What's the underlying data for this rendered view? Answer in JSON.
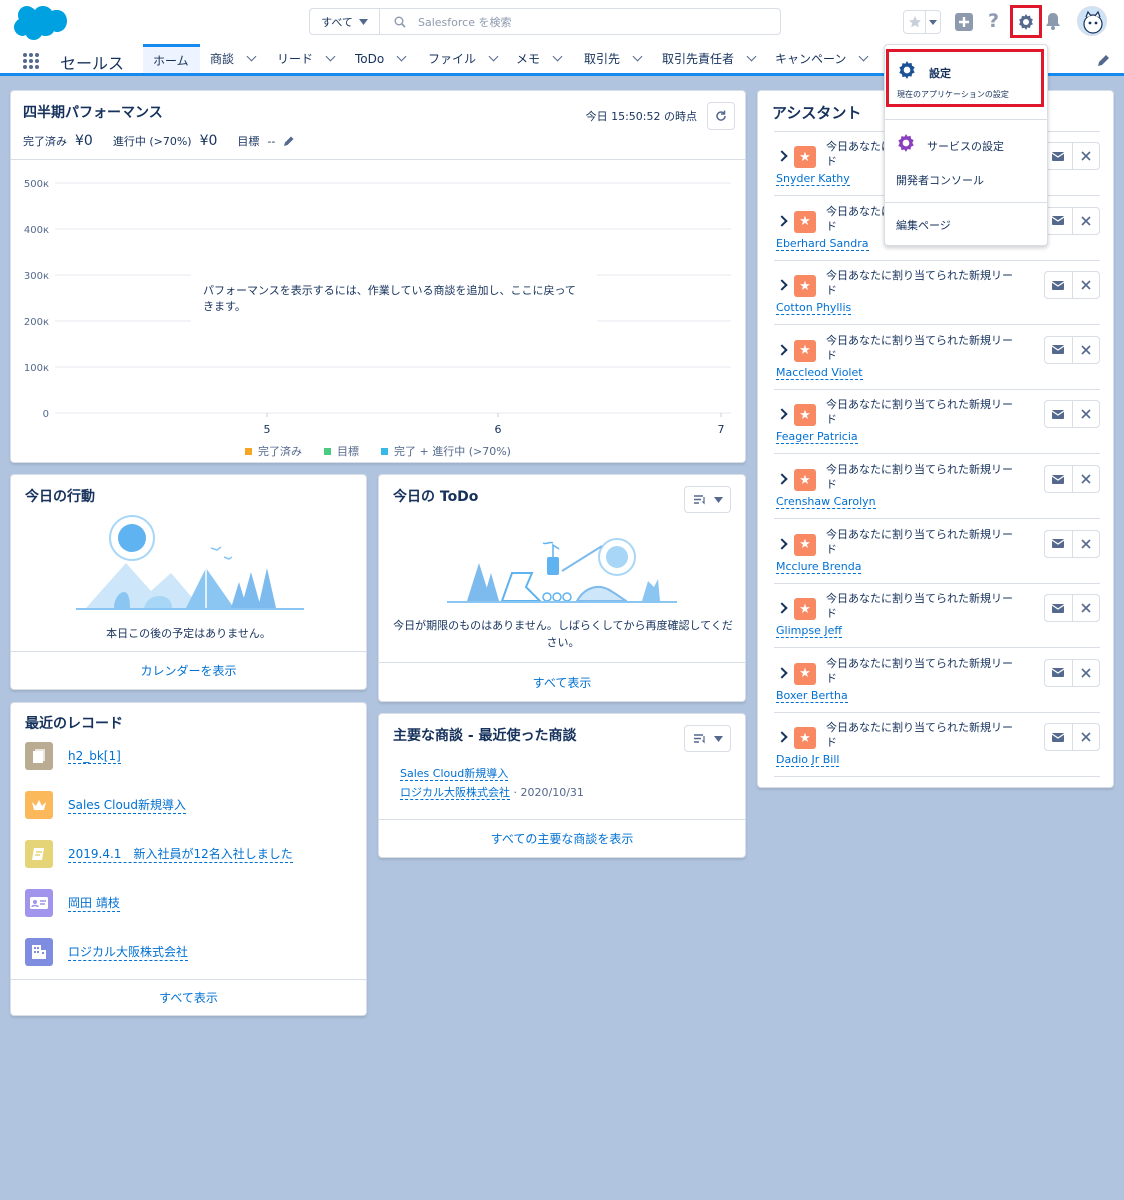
{
  "header": {
    "search_scope": "すべて",
    "search_placeholder": "Salesforce を検索"
  },
  "nav": {
    "app_name": "セールス",
    "items": [
      {
        "label": "ホーム"
      },
      {
        "label": "商談"
      },
      {
        "label": "リード"
      },
      {
        "label": "ToDo"
      },
      {
        "label": "ファイル"
      },
      {
        "label": "メモ"
      },
      {
        "label": "取引先"
      },
      {
        "label": "取引先責任者"
      },
      {
        "label": "キャンペーン"
      }
    ]
  },
  "performance": {
    "title": "四半期パフォーマンス",
    "timestamp": "今日 15:50:52 の時点",
    "closed_label": "完了済み",
    "closed_value": "¥0",
    "open_label": "進行中 (>70%)",
    "open_value": "¥0",
    "goal_label": "目標",
    "goal_value": "--",
    "empty_message": "パフォーマンスを表示するには、作業している商談を追加し、ここに戻ってきます。",
    "legend": [
      "完了済み",
      "目標",
      "完了 + 進行中 (>70%)"
    ]
  },
  "chart_data": {
    "type": "line",
    "x": [
      "5",
      "6",
      "7"
    ],
    "yticks": [
      "500к",
      "400к",
      "300к",
      "200к",
      "100к",
      "0"
    ],
    "ylim": [
      0,
      500000
    ],
    "series": [
      {
        "name": "完了済み",
        "values": [],
        "color": "#f5a623"
      },
      {
        "name": "目標",
        "values": [],
        "color": "#4bca81"
      },
      {
        "name": "完了 + 進行中 (>70%)",
        "values": [],
        "color": "#36b9e5"
      }
    ],
    "legend_position": "bottom",
    "grid": true
  },
  "events": {
    "title": "今日の行動",
    "empty_message": "本日この後の予定はありません。",
    "footer_link": "カレンダーを表示"
  },
  "todo": {
    "title": "今日の ToDo",
    "empty_message": "今日が期限のものはありません。しばらくしてから再度確認してください。",
    "footer_link": "すべて表示"
  },
  "recent": {
    "title": "最近のレコード",
    "items": [
      {
        "label": "h2_bk[1]",
        "icon": "file-icon",
        "color": "#baac93"
      },
      {
        "label": "Sales Cloud新規導入",
        "icon": "crown-icon",
        "color": "#fcb95b"
      },
      {
        "label": "2019.4.1　新入社員が12名入社しました",
        "icon": "announcement-icon",
        "color": "#e6d478"
      },
      {
        "label": "岡田 靖枝",
        "icon": "contact-card-icon",
        "color": "#a094ed"
      },
      {
        "label": "ロジカル大阪株式会社",
        "icon": "building-icon",
        "color": "#7f8de1"
      }
    ],
    "footer_link": "すべて表示"
  },
  "deals": {
    "title": "主要な商談 - 最近使った商談",
    "deal_name": "Sales Cloud新規導入",
    "account": "ロジカル大阪株式会社",
    "date_sep": "· 2020/10/31",
    "footer_link": "すべての主要な商談を表示"
  },
  "assistant": {
    "title": "アシスタント",
    "item_text": "今日あなたに割り当てられた新規リード",
    "item_text_cut": "今日あなたに割り当てられた新規リー",
    "item_text_short": "今日あなたに割り当てられた新規リード",
    "items": [
      {
        "line1": "今日あなたに",
        "line2": "ド",
        "name": "Snyder Kathy"
      },
      {
        "line1": "今日あなたに",
        "line2": "ド",
        "name": "Eberhard Sandra"
      },
      {
        "line1": "今日あなたに割り当てられた新規リー",
        "line2": "ド",
        "name": "Cotton Phyllis"
      },
      {
        "line1": "今日あなたに割り当てられた新規リー",
        "line2": "ド",
        "name": "Maccleod Violet"
      },
      {
        "line1": "今日あなたに割り当てられた新規リー",
        "line2": "ド",
        "name": "Feager Patricia"
      },
      {
        "line1": "今日あなたに割り当てられた新規リー",
        "line2": "ド",
        "name": "Crenshaw Carolyn"
      },
      {
        "line1": "今日あなたに割り当てられた新規リー",
        "line2": "ド",
        "name": "Mcclure Brenda"
      },
      {
        "line1": "今日あなたに割り当てられた新規リー",
        "line2": "ド",
        "name": "Glimpse Jeff"
      },
      {
        "line1": "今日あなたに割り当てられた新規リー",
        "line2": "ド",
        "name": "Boxer Bertha"
      },
      {
        "line1": "今日あなたに割り当てられた新規リー",
        "line2": "ド",
        "name": "Dadio Jr Bill"
      }
    ]
  },
  "setup_menu": {
    "setup_label": "設定",
    "setup_sub": "現在のアプリケーションの設定",
    "service_label": "サービスの設定",
    "dev_console": "開発者コンソール",
    "edit_page": "編集ページ",
    "highlight_color": "#e0162b"
  }
}
